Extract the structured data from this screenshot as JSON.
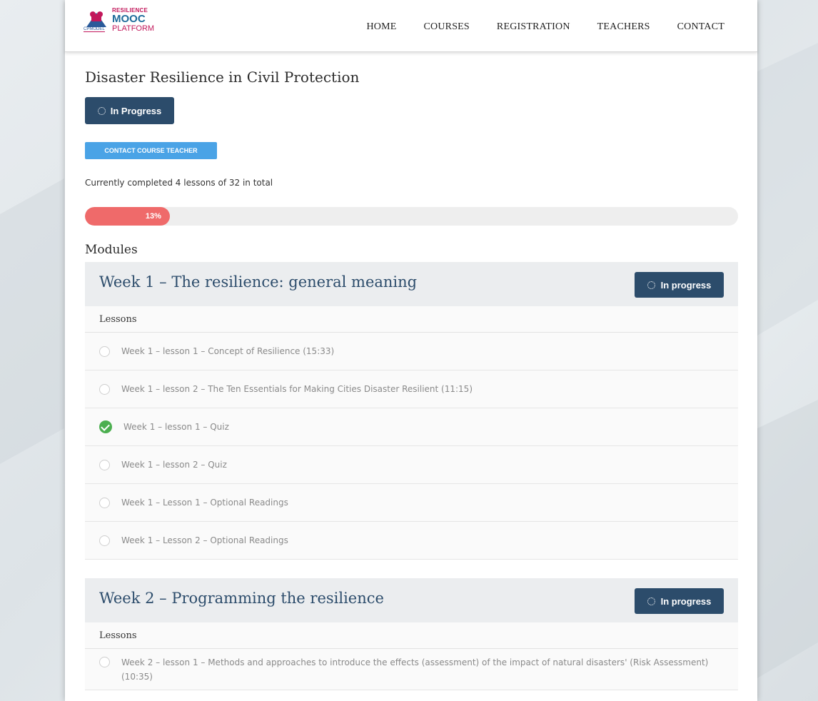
{
  "logo": {
    "line1": "RESILIENCE",
    "line2": "MOOC",
    "line3": "PLATFORM",
    "line4": "CPMODEL"
  },
  "nav": [
    "HOME",
    "COURSES",
    "REGISTRATION",
    "TEACHERS",
    "CONTACT"
  ],
  "course": {
    "title": "Disaster Resilience in Civil Protection",
    "status_label": "In Progress",
    "contact_button": "CONTACT COURSE TEACHER",
    "completed_text": "Currently completed 4 lessons of 32 in total",
    "progress_label": "13%",
    "progress_value": 13
  },
  "modules_label": "Modules",
  "modules": [
    {
      "title": "Week 1 – The resilience: general meaning",
      "status": "In progress",
      "lessons_label": "Lessons",
      "lessons": [
        {
          "label": "Week 1 – lesson 1 – Concept of Resilience (15:33)",
          "done": false
        },
        {
          "label": "Week 1 – lesson 2 – The Ten Essentials for Making Cities Disaster Resilient (11:15)",
          "done": false
        },
        {
          "label": "Week 1 – lesson 1 – Quiz",
          "done": true
        },
        {
          "label": "Week 1 – lesson 2 – Quiz",
          "done": false
        },
        {
          "label": "Week 1 – Lesson 1 – Optional Readings",
          "done": false
        },
        {
          "label": "Week 1 – Lesson 2 – Optional Readings",
          "done": false
        }
      ]
    },
    {
      "title": "Week 2 – Programming the resilience",
      "status": "In progress",
      "lessons_label": "Lessons",
      "lessons": [
        {
          "label": "Week 2 – lesson 1 – Methods and approaches to introduce the effects (assessment) of the impact of natural disasters' (Risk Assessment) (10:35)",
          "done": false
        }
      ]
    }
  ],
  "colors": {
    "primary": "#2c4c6b",
    "accent_blue": "#4aa3e6",
    "progress_red": "#ef6a6a",
    "check_green": "#4caf50"
  }
}
